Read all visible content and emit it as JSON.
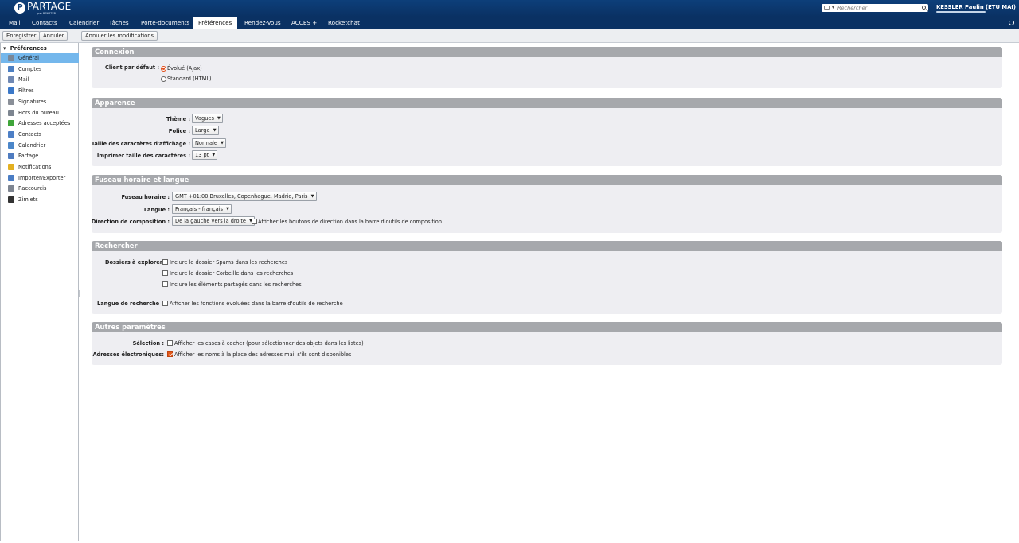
{
  "header": {
    "logo_text": "PARTAGE",
    "logo_sub": "par RENATER",
    "logo_letter": "P",
    "search_placeholder": "Rechercher",
    "user_name": "KESSLER Paulin (ETU MAI)"
  },
  "tabs": [
    "Mail",
    "Contacts",
    "Calendrier",
    "Tâches",
    "Porte-documents",
    "Préférences",
    "Rendez-Vous",
    "ACCES +",
    "Rocketchat"
  ],
  "active_tab": "Préférences",
  "toolbar": {
    "save_label": "Enregistrer",
    "cancel_label": "Annuler",
    "undo_label": "Annuler les modifications"
  },
  "sidebar": {
    "header": "Préférences",
    "toggle": "▾",
    "items": [
      {
        "label": "Général",
        "icon": "gear-icon",
        "color": "#7a8797"
      },
      {
        "label": "Comptes",
        "icon": "accounts-icon",
        "color": "#4c7fc2"
      },
      {
        "label": "Mail",
        "icon": "mail-icon",
        "color": "#6f88b3"
      },
      {
        "label": "Filtres",
        "icon": "filter-icon",
        "color": "#3b78c8"
      },
      {
        "label": "Signatures",
        "icon": "signature-icon",
        "color": "#8a8f98"
      },
      {
        "label": "Hors du bureau",
        "icon": "out-of-office-icon",
        "color": "#7d8590"
      },
      {
        "label": "Adresses acceptées",
        "icon": "shield-icon",
        "color": "#3fa53a"
      },
      {
        "label": "Contacts",
        "icon": "contacts-icon",
        "color": "#4d7fc6"
      },
      {
        "label": "Calendrier",
        "icon": "calendar-icon",
        "color": "#4b86c9"
      },
      {
        "label": "Partage",
        "icon": "share-icon",
        "color": "#4f7cc0"
      },
      {
        "label": "Notifications",
        "icon": "bell-icon",
        "color": "#e3b021"
      },
      {
        "label": "Importer/Exporter",
        "icon": "import-export-icon",
        "color": "#4a7dc4"
      },
      {
        "label": "Raccourcis",
        "icon": "shortcuts-icon",
        "color": "#7e8591"
      },
      {
        "label": "Zimlets",
        "icon": "zimlets-icon",
        "color": "#333333"
      }
    ]
  },
  "sections": {
    "connexion": {
      "title": "Connexion",
      "client_label": "Client par défaut :",
      "option_ajax": "Évolué (Ajax)",
      "option_html": "Standard (HTML)"
    },
    "apparence": {
      "title": "Apparence",
      "theme_label": "Thème :",
      "theme_value": "Vagues",
      "font_label": "Police :",
      "font_value": "Large",
      "size_label": "Taille des caractères d'affichage :",
      "size_value": "Normale",
      "print_label": "Imprimer taille des caractères :",
      "print_value": "13 pt"
    },
    "fuseau": {
      "title": "Fuseau horaire et langue",
      "tz_label": "Fuseau horaire :",
      "tz_value": "GMT +01:00 Bruxelles, Copenhague, Madrid, Paris",
      "lang_label": "Langue :",
      "lang_value": "Français - français",
      "dir_label": "Direction de composition :",
      "dir_value": "De la gauche vers la droite",
      "dir_check": "Afficher les boutons de direction dans la barre d'outils de composition"
    },
    "rechercher": {
      "title": "Rechercher",
      "folders_label": "Dossiers à explorer",
      "opt_spam": "Inclure le dossier Spams dans les recherches",
      "opt_trash": "Inclure le dossier Corbeille dans les recherches",
      "opt_shared": "Inclure les éléments partagés dans les recherches",
      "lang_label": "Langue de recherche :",
      "lang_check": "Afficher les fonctions évoluées dans la barre d'outils de recherche"
    },
    "autres": {
      "title": "Autres paramètres",
      "selection_label": "Sélection :",
      "selection_check": "Afficher les cases à cocher (pour sélectionner des objets dans les listes)",
      "addresses_label": "Adresses électroniques:",
      "addresses_check": "Afficher les noms à la place des adresses mail s'ils sont disponibles"
    }
  }
}
